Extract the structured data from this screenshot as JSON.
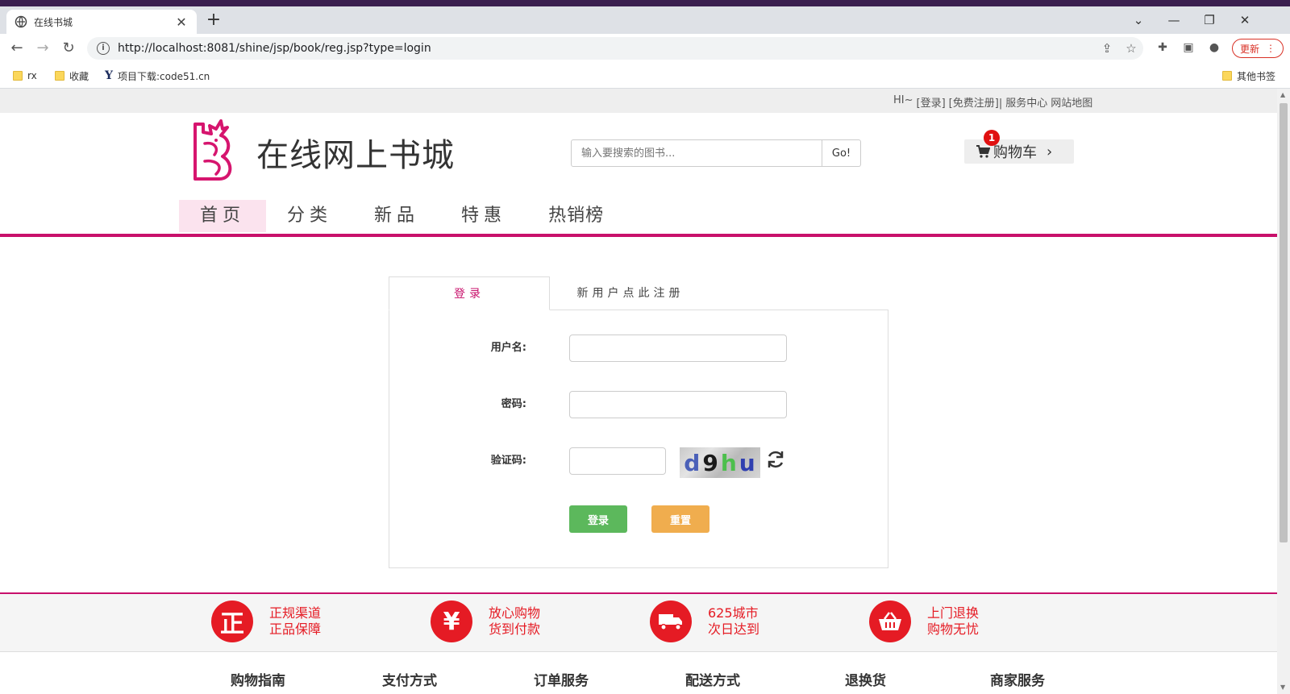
{
  "browser": {
    "tab_title": "在线书城",
    "url": "http://localhost:8081/shine/jsp/book/reg.jsp?type=login",
    "update_label": "更新",
    "bookmarks": [
      {
        "label": "rx"
      },
      {
        "label": "收藏"
      },
      {
        "label": "项目下载:code51.cn"
      }
    ],
    "other_bookmarks": "其他书签"
  },
  "topbar": {
    "greeting": "HI~",
    "login": "[登录]",
    "register": "[免费注册]|",
    "service": "服务中心",
    "sitemap": "网站地图"
  },
  "header": {
    "site_title": "在线网上书城",
    "search_placeholder": "输入要搜索的图书...",
    "search_button": "Go!",
    "cart_label": "购物车",
    "cart_count": "1"
  },
  "nav": [
    {
      "label": "首页"
    },
    {
      "label": "分类"
    },
    {
      "label": "新品"
    },
    {
      "label": "特惠"
    },
    {
      "label": "热销榜"
    }
  ],
  "login": {
    "tab_login": "登录",
    "tab_register": "新用户点此注册",
    "username_label": "用户名:",
    "password_label": "密码:",
    "captcha_label": "验证码:",
    "captcha_text": [
      "d",
      "9",
      "h",
      "u"
    ],
    "submit_label": "登录",
    "reset_label": "重置"
  },
  "features": [
    {
      "icon": "正",
      "line1": "正规渠道",
      "line2": "正品保障"
    },
    {
      "icon": "¥",
      "line1": "放心购物",
      "line2": "货到付款"
    },
    {
      "icon": "truck",
      "line1": "625城市",
      "line2": "次日达到"
    },
    {
      "icon": "basket",
      "line1": "上门退换",
      "line2": "购物无忧"
    }
  ],
  "guides": [
    "购物指南",
    "支付方式",
    "订单服务",
    "配送方式",
    "退换货",
    "商家服务"
  ],
  "colors": {
    "brand": "#c8106b",
    "feature_red": "#e51b24",
    "login_green": "#5cb85c",
    "reset_orange": "#f0ad4e"
  }
}
